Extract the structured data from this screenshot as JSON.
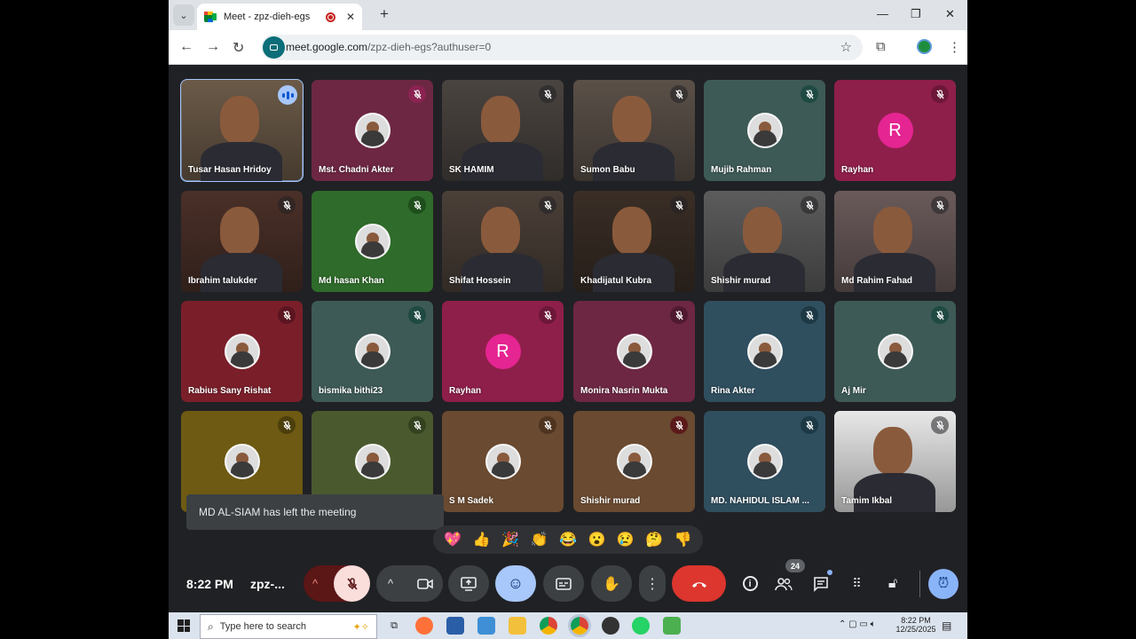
{
  "browser": {
    "tab_title": "Meet - zpz-dieh-egs",
    "url_host": "meet.google.com",
    "url_path": "/zpz-dieh-egs?authuser=0"
  },
  "participants": [
    {
      "name": "Tusar Hasan Hridoy",
      "bg": "#6b5a48",
      "kind": "video",
      "muted": false,
      "speaking": true
    },
    {
      "name": "Mst. Chadni Akter",
      "bg": "#6d2743",
      "kind": "avatar",
      "muted": true,
      "mic_bg": "#8b2352"
    },
    {
      "name": "SK HAMIM",
      "bg": "#4a4440",
      "kind": "video",
      "muted": true
    },
    {
      "name": "Sumon Babu",
      "bg": "#5a5048",
      "kind": "video",
      "muted": true
    },
    {
      "name": "Mujib Rahman",
      "bg": "#3d5a56",
      "kind": "avatar",
      "muted": true,
      "mic_bg": "#1f4a43"
    },
    {
      "name": "Rayhan",
      "bg": "#8e1f4a",
      "kind": "letter",
      "letter": "R",
      "muted": true,
      "mic_bg": "#6d1738"
    },
    {
      "name": "Ibrahim talukder",
      "bg": "#4a3028",
      "kind": "video",
      "muted": true
    },
    {
      "name": "Md hasan Khan",
      "bg": "#2f6b2a",
      "kind": "avatar",
      "muted": true,
      "mic_bg": "#1e4f1b"
    },
    {
      "name": "Shifat Hossein",
      "bg": "#4b4038",
      "kind": "video",
      "muted": true
    },
    {
      "name": "Khadijatul Kubra",
      "bg": "#3a2e26",
      "kind": "video",
      "muted": true
    },
    {
      "name": "Shishir murad",
      "bg": "#5c5c5c",
      "kind": "video",
      "muted": true
    },
    {
      "name": "Md Rahim Fahad",
      "bg": "#6a5a5a",
      "kind": "video",
      "muted": true
    },
    {
      "name": "Rabius Sany Rishat",
      "bg": "#7a1f2a",
      "kind": "avatar",
      "muted": true,
      "mic_bg": "#5b1520"
    },
    {
      "name": "bismika bithi23",
      "bg": "#3d5a56",
      "kind": "avatar",
      "muted": true,
      "mic_bg": "#1f4a43"
    },
    {
      "name": "Rayhan",
      "bg": "#8e1f4a",
      "kind": "letter",
      "letter": "R",
      "muted": true,
      "mic_bg": "#6d1738"
    },
    {
      "name": "Monira Nasrin Mukta",
      "bg": "#6d2743",
      "kind": "avatar",
      "muted": true,
      "mic_bg": "#4f1a31"
    },
    {
      "name": "Rina Akter",
      "bg": "#2f4e5e",
      "kind": "avatar",
      "muted": true,
      "mic_bg": "#1d3945"
    },
    {
      "name": "Aj Mir",
      "bg": "#3d5a56",
      "kind": "avatar",
      "muted": true,
      "mic_bg": "#1f4a43"
    },
    {
      "name": "",
      "bg": "#6e5a12",
      "kind": "avatar",
      "muted": true,
      "mic_bg": "#4d3f0c"
    },
    {
      "name": "",
      "bg": "#4a5a2e",
      "kind": "avatar",
      "muted": true,
      "mic_bg": "#34421f"
    },
    {
      "name": "S M Sadek",
      "bg": "#6a4a30",
      "kind": "avatar",
      "muted": true,
      "mic_bg": "#4f3420"
    },
    {
      "name": "Shishir murad",
      "bg": "#6a4a30",
      "kind": "avatar",
      "muted": true,
      "mic_bg": "#5b1a1a"
    },
    {
      "name": "MD. NAHIDUL ISLAM ...",
      "bg": "#2f4e5e",
      "kind": "avatar",
      "muted": true,
      "mic_bg": "#1d3945"
    },
    {
      "name": "Tamim Ikbal",
      "bg": "#e8e8e8",
      "kind": "video",
      "muted": true
    }
  ],
  "toast": "MD AL-SIAM has left the meeting",
  "reactions": [
    "💖",
    "👍",
    "🎉",
    "👏",
    "😂",
    "😮",
    "😢",
    "🤔",
    "👎"
  ],
  "controls": {
    "time": "8:22 PM",
    "meeting_code": "zpz-...",
    "people_count": "24"
  },
  "taskbar": {
    "search_placeholder": "Type here to search",
    "time": "8:22 PM",
    "date": "12/25/2025"
  }
}
